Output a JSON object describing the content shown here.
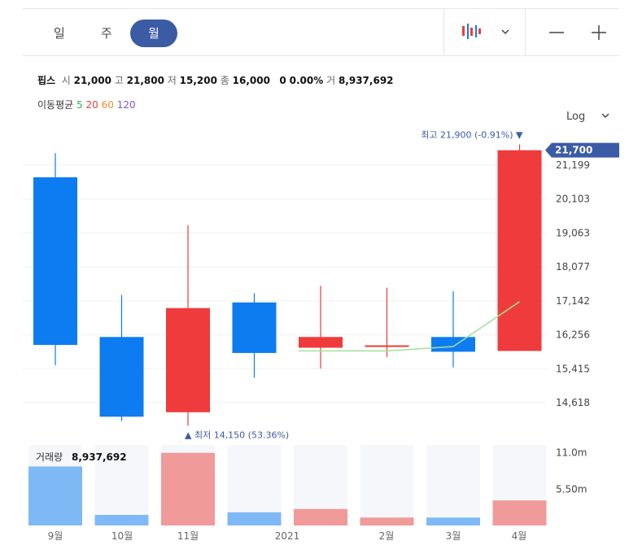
{
  "periods": {
    "day": "일",
    "week": "주",
    "month": "월",
    "active": "월"
  },
  "stock": {
    "name": "핍스",
    "open_label": "시",
    "open": "21,000",
    "high_label": "고",
    "high": "21,800",
    "low_label": "저",
    "low": "15,200",
    "close_label": "종",
    "close": "16,000",
    "change": "0",
    "change_pct": "0.00%",
    "volume_label": "거",
    "volume": "8,937,692"
  },
  "moving_avg": {
    "label": "이동평균",
    "p5": "5",
    "p20": "20",
    "p60": "60",
    "p120": "120",
    "colors": {
      "p5": "#2bb34a",
      "p20": "#e8433a",
      "p60": "#f08c2e",
      "p120": "#7b57c9"
    }
  },
  "scale_label": "Log",
  "colors": {
    "up": "#ef3b3b",
    "down": "#0d7cf0",
    "vol_up": "#f09a9a",
    "vol_down": "#7fb9f5",
    "ma5": "#9fe29a",
    "badge": "#3b5ba5"
  },
  "chart_data": {
    "type": "candlestick",
    "scale": "log",
    "ylim": [
      14150,
      21900
    ],
    "y_ticks": [
      "21,199",
      "20,103",
      "19,063",
      "18,077",
      "17,142",
      "16,256",
      "15,415",
      "14,618"
    ],
    "y_tick_values": [
      21199,
      20103,
      19063,
      18077,
      17142,
      16256,
      15415,
      14618
    ],
    "current_price": "21,700",
    "current_value": 21700,
    "high_annotation": "최고 21,900 (-0.91%) ▼",
    "high_value": 21900,
    "low_annotation": "▲ 최저 14,150 (53.36%)",
    "low_value": 14150,
    "candles": [
      {
        "open": 20800,
        "high": 21600,
        "low": 15500,
        "close": 16000
      },
      {
        "open": 16200,
        "high": 17300,
        "low": 14200,
        "close": 14300
      },
      {
        "open": 14400,
        "high": 19300,
        "low": 14100,
        "close": 16950
      },
      {
        "open": 17100,
        "high": 17350,
        "low": 15200,
        "close": 15800
      },
      {
        "open": 15930,
        "high": 17550,
        "low": 15420,
        "close": 16200
      },
      {
        "open": 15960,
        "high": 17500,
        "low": 15700,
        "close": 15990
      },
      {
        "open": 16200,
        "high": 17400,
        "low": 15450,
        "close": 15830
      },
      {
        "open": 15850,
        "high": 21900,
        "low": 15850,
        "close": 21700
      }
    ],
    "ma5": [
      null,
      null,
      null,
      null,
      15850,
      15850,
      15960,
      17120
    ],
    "volume_label": "거래량",
    "volume_value": "8,937,692",
    "volume_ticks": [
      "11.0m",
      "5.50m"
    ],
    "volume_tick_values": [
      11000000,
      5500000
    ],
    "volumes": [
      8937692,
      1600000,
      11000000,
      2000000,
      2500000,
      1200000,
      1200000,
      3800000
    ],
    "x_labels": [
      "9월",
      "10월",
      "11월",
      "2021",
      "2월",
      "3월",
      "4월"
    ],
    "x_label_index": [
      0,
      1,
      2,
      3,
      4,
      5,
      6
    ]
  }
}
